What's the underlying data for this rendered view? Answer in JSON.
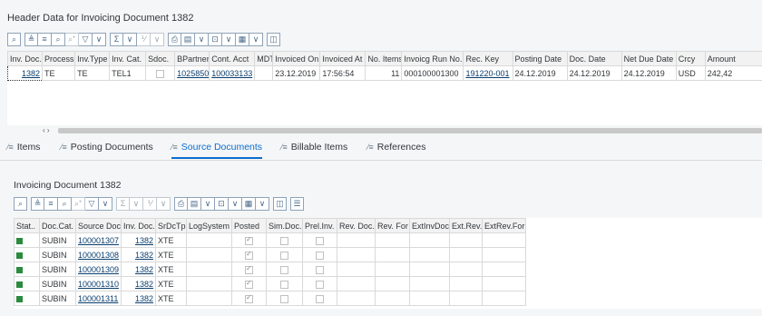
{
  "header": {
    "title": "Header Data for Invoicing Document 1382",
    "columns": [
      "Inv. Doc.",
      "Process",
      "Inv.Type",
      "Inv. Cat.",
      "Sdoc.",
      "BPartner",
      "Cont. Acct",
      "MDT",
      "Invoiced On",
      "Invoiced At",
      "No. Items",
      "Invoicg Run No.",
      "Rec. Key",
      "Posting Date",
      "Doc. Date",
      "Net Due Date",
      "Crcy",
      "Amount"
    ],
    "row": {
      "inv_doc": "1382",
      "process": "TE",
      "inv_type": "TE",
      "inv_cat": "TEL1",
      "bpartner": "1025850",
      "cont_acct": "100033133",
      "mdt": "",
      "invoiced_on": "23.12.2019",
      "invoiced_at": "17:56:54",
      "no_items": "11",
      "run_no": "000100001300",
      "rec_key": "191220-001",
      "posting_date": "24.12.2019",
      "doc_date": "24.12.2019",
      "net_due_date": "24.12.2019",
      "crcy": "USD",
      "amount": "242,42"
    }
  },
  "tabs": [
    {
      "label": "Items",
      "icon": "list-icon"
    },
    {
      "label": "Posting Documents",
      "icon": "list-icon"
    },
    {
      "label": "Source Documents",
      "icon": "list-icon"
    },
    {
      "label": "Billable Items",
      "icon": "list-icon"
    },
    {
      "label": "References",
      "icon": "list-icon"
    }
  ],
  "source": {
    "title": "Invoicing Document 1382",
    "columns": [
      "Stat..",
      "Doc.Cat.",
      "Source Doc",
      "Inv. Doc.",
      "SrDcTp",
      "LogSystem",
      "Posted",
      "Sim.Doc.",
      "Prel.Inv.",
      "Rev. Doc.",
      "Rev. For",
      "ExtInvDoc.",
      "Ext.Rev.",
      "ExtRev.For"
    ],
    "rows": [
      {
        "doc_cat": "SUBIN",
        "source_doc": "100001307",
        "inv_doc": "1382",
        "type": "XTE"
      },
      {
        "doc_cat": "SUBIN",
        "source_doc": "100001308",
        "inv_doc": "1382",
        "type": "XTE"
      },
      {
        "doc_cat": "SUBIN",
        "source_doc": "100001309",
        "inv_doc": "1382",
        "type": "XTE"
      },
      {
        "doc_cat": "SUBIN",
        "source_doc": "100001310",
        "inv_doc": "1382",
        "type": "XTE"
      },
      {
        "doc_cat": "SUBIN",
        "source_doc": "100001311",
        "inv_doc": "1382",
        "type": "XTE"
      }
    ]
  },
  "toolbar_icons": [
    "zoom-icon",
    "sort-asc-icon",
    "filter-icon",
    "find-icon",
    "find-next-icon",
    "filter-funnel-icon",
    "sum-icon",
    "subtotal-icon",
    "print-icon",
    "view-icon",
    "export-icon",
    "layout-icon",
    "details-icon"
  ],
  "toolbar_symbols": {
    "zoom": "⌕",
    "sort": "≜",
    "filter": "≡",
    "find": "⌕",
    "findnext": "⌕⁺",
    "funnel": "▽",
    "sum": "Σ",
    "subtotal": "⅟",
    "print": "⎙",
    "view": "▤",
    "export": "⊡",
    "layout": "▦",
    "details": "◫",
    "chev": "∨",
    "extra": "☰"
  },
  "colors": {
    "accent": "#0a6ed1",
    "status_green": "#2b8a3e",
    "link": "#0a3e6e"
  }
}
